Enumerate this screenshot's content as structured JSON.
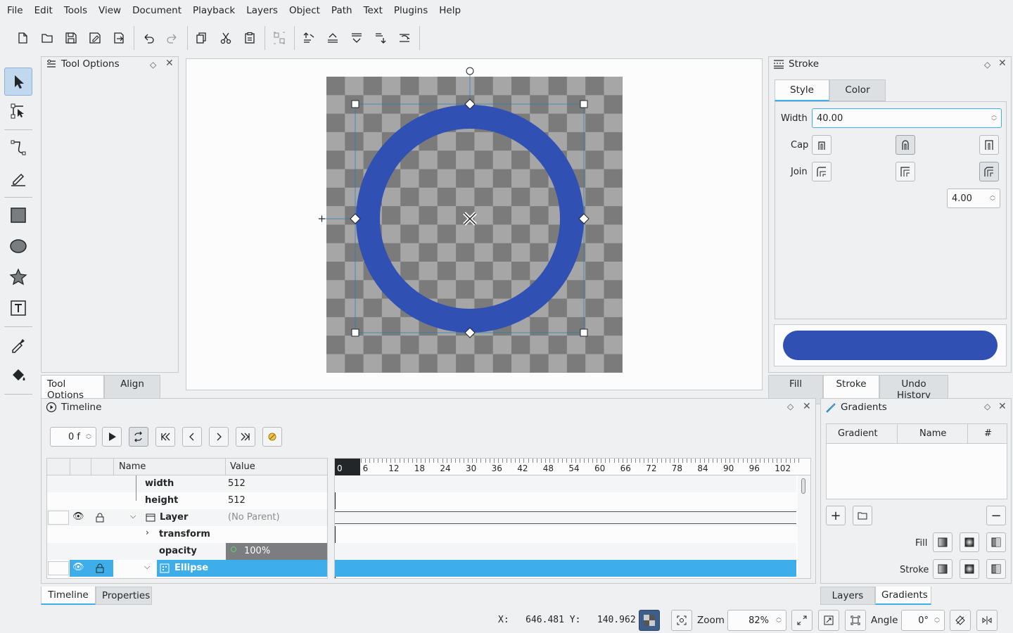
{
  "menu": [
    "File",
    "Edit",
    "Tools",
    "View",
    "Document",
    "Playback",
    "Layers",
    "Object",
    "Path",
    "Text",
    "Plugins",
    "Help"
  ],
  "icons": {
    "new": "new-document-icon",
    "open": "open-folder-icon",
    "save": "save-icon",
    "save_as": "save-as-icon",
    "export": "export-icon",
    "undo": "undo-icon",
    "redo": "redo-icon",
    "copy": "copy-icon",
    "cut": "cut-icon",
    "paste": "paste-icon",
    "group": "group-icon",
    "raise_top": "raise-to-top-icon",
    "raise": "raise-icon",
    "lower": "lower-icon",
    "lower_bottom": "lower-to-bottom-icon",
    "flip": "flip-icon"
  },
  "tools": [
    "select-tool-icon",
    "edit-nodes-tool-icon",
    "bezier-tool-icon",
    "freehand-draw-tool-icon",
    "rectangle-tool-icon",
    "ellipse-tool-icon",
    "star-tool-icon",
    "text-tool-icon",
    "color-picker-tool-icon",
    "fill-tool-icon"
  ],
  "tool_options": {
    "title": "Tool Options",
    "tabs": [
      "Tool Options",
      "Align"
    ]
  },
  "stroke_panel": {
    "title": "Stroke",
    "tabs": [
      "Style",
      "Color"
    ],
    "width_label": "Width",
    "width_value": "40.00",
    "cap_label": "Cap",
    "join_label": "Join",
    "miter_value": "4.00",
    "preview_color": "#3050b3",
    "bottom_tabs": [
      "Fill",
      "Stroke",
      "Undo History"
    ]
  },
  "canvas": {
    "stroke_color": "#3050b3",
    "checker_dark": "#7b7b7b",
    "checker_light": "#a6a6a6"
  },
  "timeline": {
    "title": "Timeline",
    "frame_value": "0 f",
    "columns": {
      "name": "Name",
      "value": "Value"
    },
    "rows": [
      {
        "name": "width",
        "value": "512"
      },
      {
        "name": "height",
        "value": "512"
      },
      {
        "name": "Layer",
        "value": "(No Parent)"
      },
      {
        "name": "transform",
        "value": ""
      },
      {
        "name": "opacity",
        "value": "100%"
      },
      {
        "name": "Ellipse",
        "value": ""
      }
    ],
    "ruler": [
      "0",
      "6",
      "12",
      "18",
      "24",
      "30",
      "36",
      "42",
      "48",
      "54",
      "60",
      "66",
      "72",
      "78",
      "84",
      "90",
      "96",
      "102"
    ],
    "bottom_tabs": [
      "Timeline",
      "Properties"
    ]
  },
  "gradients": {
    "title": "Gradients",
    "columns": [
      "Gradient",
      "Name",
      "#"
    ],
    "fill_label": "Fill",
    "stroke_label": "Stroke",
    "bottom_tabs": [
      "Layers",
      "Gradients"
    ]
  },
  "status": {
    "coords": "X:   646.481 Y:   140.962",
    "zoom_label": "Zoom",
    "zoom_value": "82%",
    "angle_label": "Angle",
    "angle_value": "0°"
  },
  "colors": {
    "accent": "#3daee9",
    "selection": "#3daee9"
  }
}
